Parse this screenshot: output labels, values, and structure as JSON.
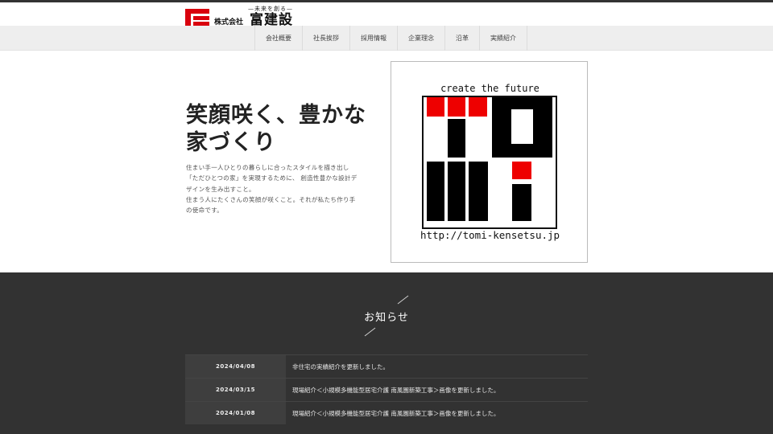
{
  "header": {
    "logo_tagline": "—未来を創る—",
    "logo_small": "株式会社",
    "logo_name": "富建設"
  },
  "nav": {
    "items": [
      {
        "label": "会社概要"
      },
      {
        "label": "社長挨拶"
      },
      {
        "label": "採用情報"
      },
      {
        "label": "企業理念"
      },
      {
        "label": "沿革"
      },
      {
        "label": "実績紹介"
      }
    ]
  },
  "hero": {
    "title_line1": "笑顔咲く、豊かな",
    "title_line2": "家づくり",
    "body_lines": [
      "住まい手一人ひとりの暮らしに合ったスタイルを描き出し",
      "「ただひとつの家」を実現するために、 創造性豊かな設計デ",
      "ザインを生み出すこと。",
      "住まう人にたくさんの笑顔が咲くこと。それが私たち作り手",
      "の使命です。"
    ],
    "image": {
      "top_text": "create the future",
      "bottom_text": "http://tomi-kensetsu.jp",
      "colors": {
        "red": "#ee0000",
        "black": "#000000"
      }
    }
  },
  "news": {
    "title": "お知らせ",
    "items": [
      {
        "date": "2024/04/08",
        "text": "非住宅の実績紹介を更新しました。"
      },
      {
        "date": "2024/03/15",
        "text": "現場紹介＜小規模多機能型居宅介護 南風園新築工事＞画像を更新しました。"
      },
      {
        "date": "2024/01/08",
        "text": "現場紹介＜小規模多機能型居宅介護 南風園新築工事＞画像を更新しました。"
      }
    ]
  },
  "colors": {
    "brand_red": "#d9000d",
    "nav_bg": "#eeeeee",
    "news_bg": "#323232"
  }
}
